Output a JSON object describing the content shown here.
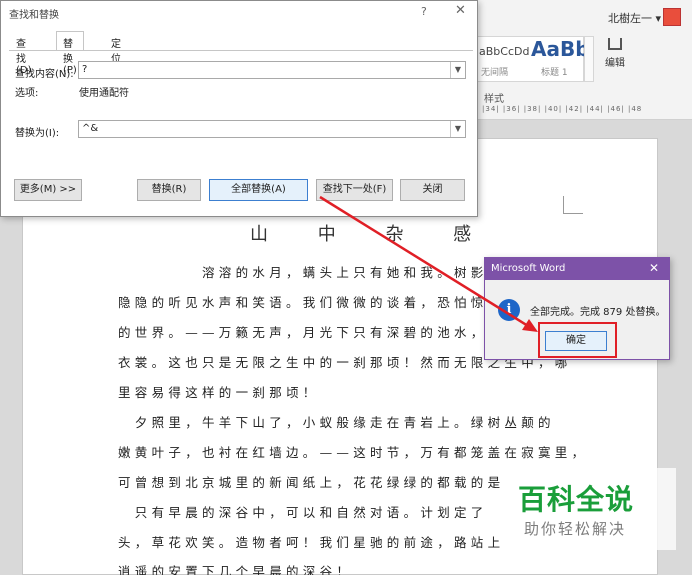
{
  "ribbon": {
    "user": "北樹左一 ▾",
    "styles_sample_a": "aBbCcDd",
    "styles_sample_b": "AaBb",
    "style_a_label": "无间隔",
    "style_b_label": "标题 1",
    "edit_label": "编辑",
    "styles_group": "样式",
    "ruler_text": "2| |34| |36| |38| |40| |42| |44| |46| |48"
  },
  "dialog": {
    "title": "查找和替换",
    "help": "?",
    "close": "✕",
    "tabs": [
      {
        "label": "查找(D)"
      },
      {
        "label": "替换(P)"
      },
      {
        "label": "定位(G)"
      }
    ],
    "find_label": "查找内容(N):",
    "find_value": "?",
    "options_label": "选项:",
    "options_value": "使用通配符",
    "replace_label": "替换为(I):",
    "replace_value": "^&",
    "buttons": {
      "more": "更多(M) >>",
      "replace": "替换(R)",
      "replace_all": "全部替换(A)",
      "find_next": "查找下一处(F)",
      "close": "关闭"
    }
  },
  "document": {
    "title": "山 中 杂 感",
    "lines": [
      "　　　　　溶溶的水月，螨头上只有她和我。树影里",
      "隐隐的听见水声和笑语。我们微微的谈着，恐怕惊",
      "的世界。——万籁无声，月光下只有深碧的池水，",
      "衣裳。这也只是无限之生中的一刹那顷！然而无限之生中，哪",
      "里容易得这样的一刹那顷！",
      "　夕照里，牛羊下山了，小蚁般缘走在青岩上。绿树丛颠的",
      "嫩黄叶子，也衬在红墙边。——这时节，万有都笼盖在寂寞里，",
      "可曾想到北京城里的新闻纸上，花花绿绿的都载的是",
      "　只有早晨的深谷中，可以和自然对语。计划定了",
      "头，草花欢笑。造物者呵！我们星驰的前途，路站上",
      "逍遥的安置下几个早晨的深谷！"
    ]
  },
  "message_box": {
    "title": "Microsoft Word",
    "close": "✕",
    "icon": "info-icon",
    "text": "全部完成。完成 879 处替换。",
    "ok": "确定"
  },
  "annotation": {
    "color": "#e01f26"
  },
  "watermark": {
    "big": "百科全说",
    "small": "助你轻松解决"
  }
}
